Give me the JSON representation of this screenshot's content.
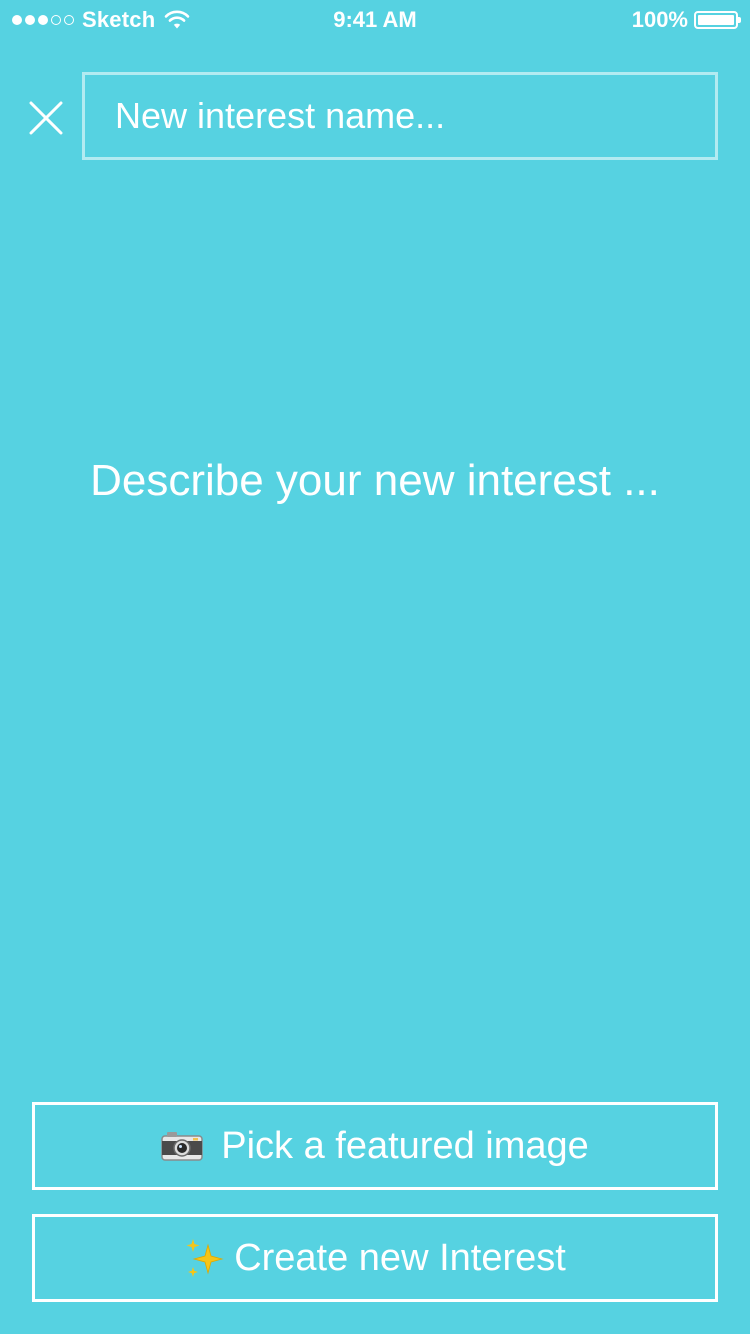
{
  "status_bar": {
    "signal_filled": 3,
    "signal_empty": 2,
    "carrier": "Sketch",
    "time": "9:41 AM",
    "battery_percent": "100%",
    "battery_level": 1.0,
    "icons": [
      "signal-icon",
      "wifi-icon",
      "battery-icon"
    ]
  },
  "header": {
    "close_icon": "close-icon",
    "name_input": {
      "placeholder": "New interest name...",
      "value": ""
    }
  },
  "main": {
    "description_placeholder": "Describe your new interest ..."
  },
  "actions": {
    "pick_image": {
      "icon": "camera-icon",
      "label": "Pick a featured image"
    },
    "create": {
      "icon": "sparkles-icon",
      "label": "Create new Interest"
    }
  },
  "colors": {
    "background": "#56d2e1",
    "foreground": "#ffffff"
  }
}
